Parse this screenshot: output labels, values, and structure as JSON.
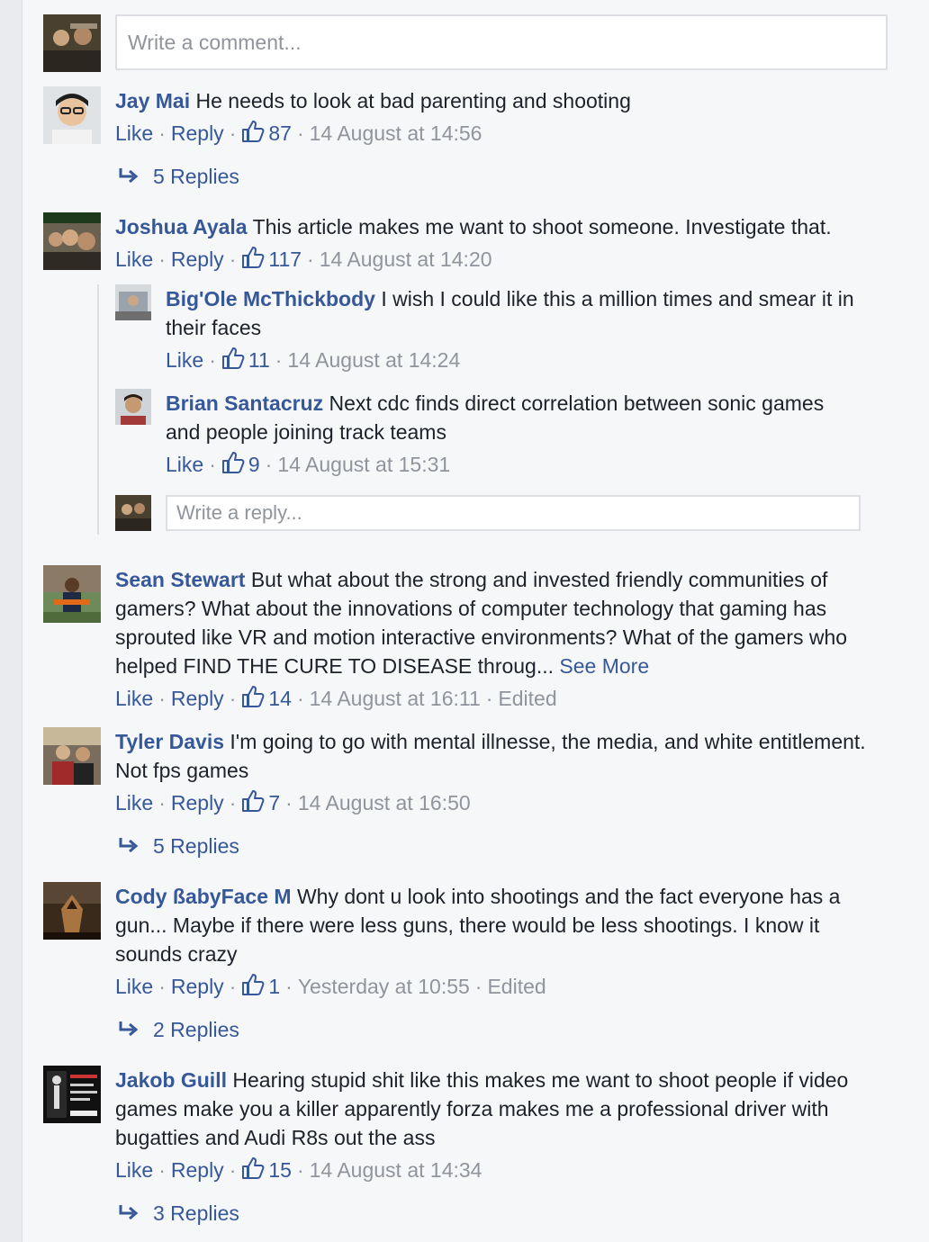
{
  "composer": {
    "placeholder": "Write a comment..."
  },
  "reply_composer": {
    "placeholder": "Write a reply..."
  },
  "actions": {
    "like": "Like",
    "reply": "Reply",
    "dot": "·"
  },
  "comments": [
    {
      "author": "Jay Mai",
      "text": "He needs to look at bad parenting and shooting",
      "likes": "87",
      "time": "14 August at 14:56",
      "replies_label": "5 Replies"
    },
    {
      "author": "Joshua Ayala",
      "text": "This article makes me want to shoot someone. Investigate that.",
      "likes": "117",
      "time": "14 August at 14:20"
    },
    {
      "author": "Sean Stewart",
      "text": "But what about the strong and invested friendly communities of gamers? What about the innovations of computer technology that gaming has sprouted like VR and motion interactive environments? What of the gamers who helped FIND THE CURE TO DISEASE throug...",
      "see_more": "See More",
      "likes": "14",
      "time": "14 August at 16:11",
      "edited": "Edited"
    },
    {
      "author": "Tyler Davis",
      "text": "I'm going to go with mental illnesse, the media, and white entitlement. Not fps games",
      "likes": "7",
      "time": "14 August at 16:50",
      "replies_label": "5 Replies"
    },
    {
      "author": "Cody ßabyFace M",
      "text": "Why dont u look into shootings and the fact everyone has a gun... Maybe if there were less guns, there would be less shootings. I know it sounds crazy",
      "likes": "1",
      "time": "Yesterday at 10:55",
      "edited": "Edited",
      "replies_label": "2 Replies"
    },
    {
      "author": "Jakob Guill",
      "text": "Hearing stupid shit like this makes me want to shoot people if video games make you a killer apparently forza makes me a professional driver with bugatties and Audi R8s out the ass",
      "likes": "15",
      "time": "14 August at 14:34",
      "replies_label": "3 Replies"
    }
  ],
  "replies": [
    {
      "author": "Big'Ole McThickbody",
      "text": "I wish I could like this a million times and smear it in their faces",
      "likes": "11",
      "time": "14 August at 14:24"
    },
    {
      "author": "Brian Santacruz",
      "text": "Next cdc finds direct correlation between sonic games and people joining track teams",
      "likes": "9",
      "time": "14 August at 15:31"
    }
  ],
  "colors": {
    "link": "#365899",
    "meta": "#90949c",
    "text": "#1d2129",
    "border": "#dddfe2",
    "background": "#f6f7f9"
  },
  "icons": {
    "like": "thumbs-up-icon",
    "replies": "reply-arrow-icon"
  }
}
